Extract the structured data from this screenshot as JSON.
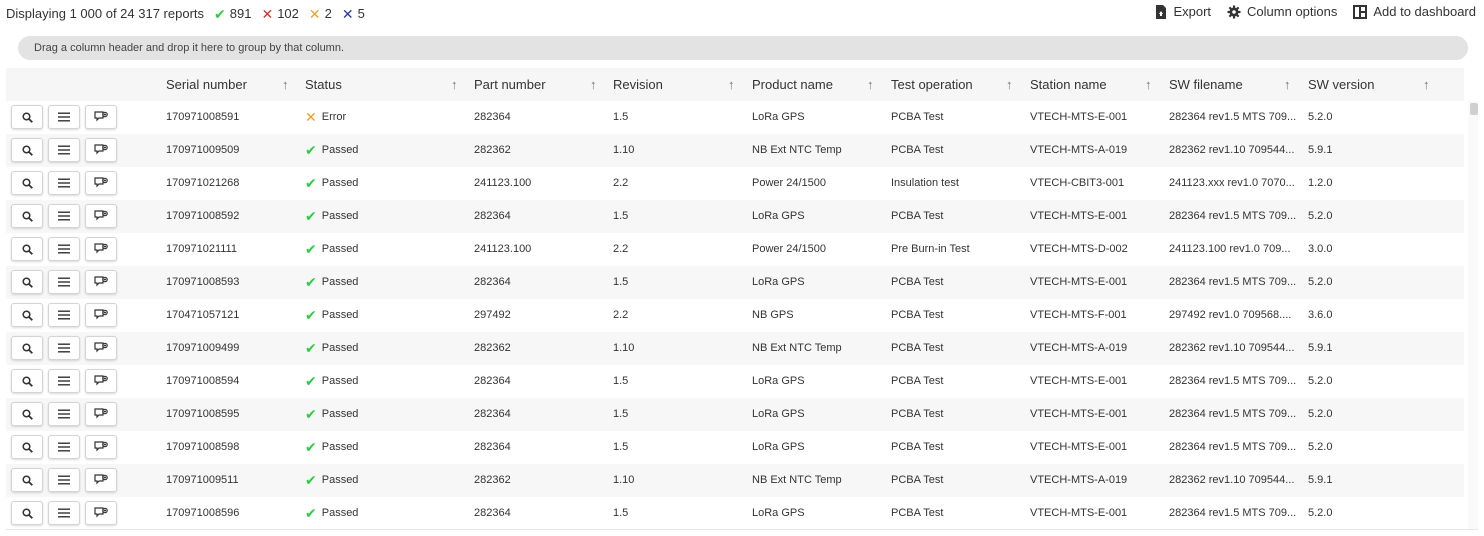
{
  "summary": {
    "text": "Displaying 1 000 of 24 317 reports",
    "counts": [
      {
        "icon": "check-icon",
        "glyph": "✔",
        "value": "891",
        "kind": "pass"
      },
      {
        "icon": "cross-icon",
        "glyph": "✕",
        "value": "102",
        "kind": "fail"
      },
      {
        "icon": "cross-icon",
        "glyph": "✕",
        "value": "2",
        "kind": "err"
      },
      {
        "icon": "cross-icon",
        "glyph": "✕",
        "value": "5",
        "kind": "abort"
      }
    ]
  },
  "actions": {
    "export": "Export",
    "column_options": "Column options",
    "add_to_dashboard": "Add to dashboard"
  },
  "group_hint": "Drag a column header and drop it here to group by that column.",
  "columns": [
    "Serial number",
    "Status",
    "Part number",
    "Revision",
    "Product name",
    "Test operation",
    "Station name",
    "SW filename",
    "SW version"
  ],
  "colors": {
    "passed": "#2ecc40",
    "error": "#f0a020",
    "failed": "#d9302b",
    "aborted": "#2b3a9e"
  },
  "rows": [
    {
      "serial": "170971008591",
      "status": "Error",
      "part": "282364",
      "revision": "1.5",
      "product": "LoRa GPS",
      "operation": "PCBA Test",
      "station": "VTECH-MTS-E-001",
      "filename": "282364 rev1.5 MTS 709...",
      "version": "5.2.0"
    },
    {
      "serial": "170971009509",
      "status": "Passed",
      "part": "282362",
      "revision": "1.10",
      "product": "NB Ext NTC Temp",
      "operation": "PCBA Test",
      "station": "VTECH-MTS-A-019",
      "filename": "282362 rev1.10 709544...",
      "version": "5.9.1"
    },
    {
      "serial": "170971021268",
      "status": "Passed",
      "part": "241123.100",
      "revision": "2.2",
      "product": "Power 24/1500",
      "operation": "Insulation test",
      "station": "VTECH-CBIT3-001",
      "filename": "241123.xxx rev1.0 7070...",
      "version": "1.2.0"
    },
    {
      "serial": "170971008592",
      "status": "Passed",
      "part": "282364",
      "revision": "1.5",
      "product": "LoRa GPS",
      "operation": "PCBA Test",
      "station": "VTECH-MTS-E-001",
      "filename": "282364 rev1.5 MTS 709...",
      "version": "5.2.0"
    },
    {
      "serial": "170971021111",
      "status": "Passed",
      "part": "241123.100",
      "revision": "2.2",
      "product": "Power 24/1500",
      "operation": "Pre Burn-in Test",
      "station": "VTECH-MTS-D-002",
      "filename": "241123.100 rev1.0 709...",
      "version": "3.0.0"
    },
    {
      "serial": "170971008593",
      "status": "Passed",
      "part": "282364",
      "revision": "1.5",
      "product": "LoRa GPS",
      "operation": "PCBA Test",
      "station": "VTECH-MTS-E-001",
      "filename": "282364 rev1.5 MTS 709...",
      "version": "5.2.0"
    },
    {
      "serial": "170471057121",
      "status": "Passed",
      "part": "297492",
      "revision": "2.2",
      "product": "NB GPS",
      "operation": "PCBA Test",
      "station": "VTECH-MTS-F-001",
      "filename": "297492 rev1.0 709568....",
      "version": "3.6.0"
    },
    {
      "serial": "170971009499",
      "status": "Passed",
      "part": "282362",
      "revision": "1.10",
      "product": "NB Ext NTC Temp",
      "operation": "PCBA Test",
      "station": "VTECH-MTS-A-019",
      "filename": "282362 rev1.10 709544...",
      "version": "5.9.1"
    },
    {
      "serial": "170971008594",
      "status": "Passed",
      "part": "282364",
      "revision": "1.5",
      "product": "LoRa GPS",
      "operation": "PCBA Test",
      "station": "VTECH-MTS-E-001",
      "filename": "282364 rev1.5 MTS 709...",
      "version": "5.2.0"
    },
    {
      "serial": "170971008595",
      "status": "Passed",
      "part": "282364",
      "revision": "1.5",
      "product": "LoRa GPS",
      "operation": "PCBA Test",
      "station": "VTECH-MTS-E-001",
      "filename": "282364 rev1.5 MTS 709...",
      "version": "5.2.0"
    },
    {
      "serial": "170971008598",
      "status": "Passed",
      "part": "282364",
      "revision": "1.5",
      "product": "LoRa GPS",
      "operation": "PCBA Test",
      "station": "VTECH-MTS-E-001",
      "filename": "282364 rev1.5 MTS 709...",
      "version": "5.2.0"
    },
    {
      "serial": "170971009511",
      "status": "Passed",
      "part": "282362",
      "revision": "1.10",
      "product": "NB Ext NTC Temp",
      "operation": "PCBA Test",
      "station": "VTECH-MTS-A-019",
      "filename": "282362 rev1.10 709544...",
      "version": "5.9.1"
    },
    {
      "serial": "170971008596",
      "status": "Passed",
      "part": "282364",
      "revision": "1.5",
      "product": "LoRa GPS",
      "operation": "PCBA Test",
      "station": "VTECH-MTS-E-001",
      "filename": "282364 rev1.5 MTS 709...",
      "version": "5.2.0"
    }
  ]
}
